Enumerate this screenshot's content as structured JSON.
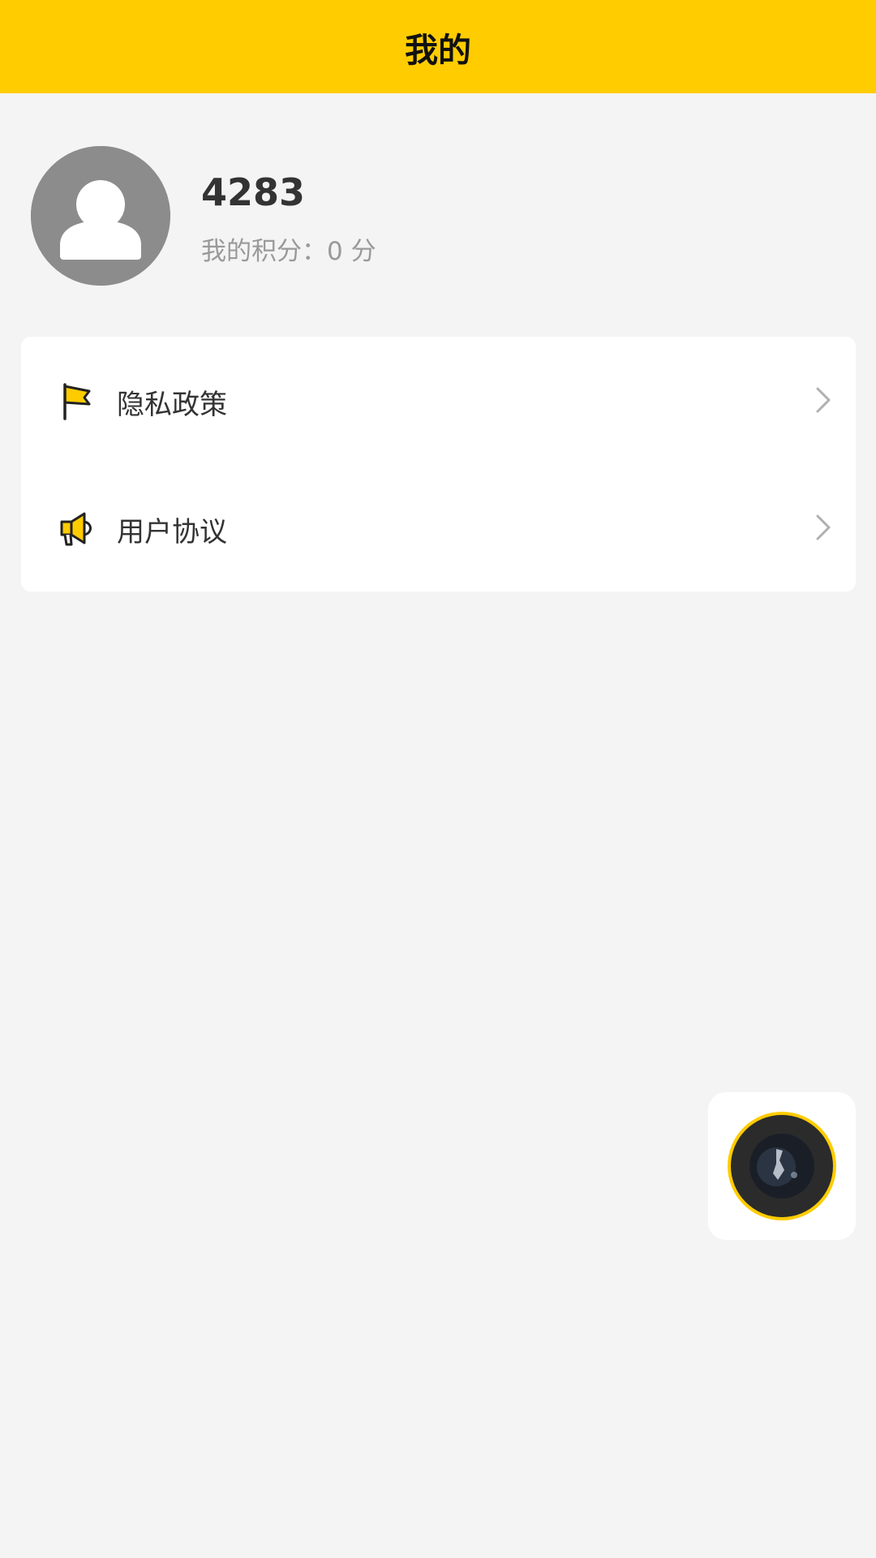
{
  "header": {
    "title": "我的"
  },
  "profile": {
    "avatar_icon": "user-avatar-icon",
    "username": "4283",
    "points_text": "我的积分：0 分"
  },
  "menu": {
    "items": [
      {
        "label": "隐私政策",
        "icon": "flag-icon"
      },
      {
        "label": "用户协议",
        "icon": "megaphone-icon"
      }
    ]
  },
  "floating_widget": {
    "icon": "music-disc-icon"
  },
  "colors": {
    "accent": "#ffcc00",
    "background": "#f4f4f4",
    "card": "#ffffff",
    "text_primary": "#333333",
    "text_secondary": "#9a9a9a",
    "avatar_bg": "#8c8c8c"
  }
}
